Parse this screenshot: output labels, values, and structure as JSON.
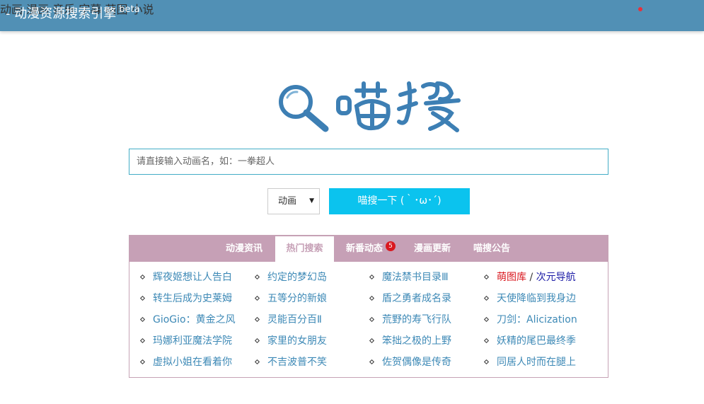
{
  "header": {
    "brand": "- 动漫资源搜索引擎",
    "beta": "beta",
    "nav": [
      "动画",
      "漫画",
      "音乐",
      "字幕",
      "萌图",
      "小说"
    ]
  },
  "logo_text": "喵搜",
  "search": {
    "placeholder": "请直接输入动画名，如：一拳超人",
    "type_selected": "动画",
    "button": "喵搜一下 (｀･ω･´)"
  },
  "tabs": {
    "items": [
      "动漫资讯",
      "热门搜索",
      "新番动态",
      "漫画更新",
      "喵搜公告"
    ],
    "active": "热门搜索",
    "badge": "5"
  },
  "hot": [
    [
      "辉夜姬想让人告白",
      "约定的梦幻岛",
      "魔法禁书目录Ⅲ",
      "萌图库"
    ],
    [
      "转生后成为史莱姆",
      "五等分的新娘",
      "盾之勇者成名录",
      "天使降临到我身边"
    ],
    [
      "GioGio：黄金之风",
      "灵能百分百Ⅱ",
      "荒野的寿飞行队",
      "刀剑：Alicization"
    ],
    [
      "玛娜利亚魔法学院",
      "家里的女朋友",
      "笨拙之极的上野",
      "妖精的尾巴最终季"
    ],
    [
      "虚拟小姐在看着你",
      "不吉波普不笑",
      "佐贺偶像是传奇",
      "同居人时而在腿上"
    ]
  ],
  "hot_extra": {
    "slash": "/",
    "nav_link": "次元导航"
  },
  "colors": {
    "navbar": "#5190b5",
    "tabbar": "#c6a0b6",
    "button": "#0bc3ee",
    "link": "#3d89b6"
  }
}
